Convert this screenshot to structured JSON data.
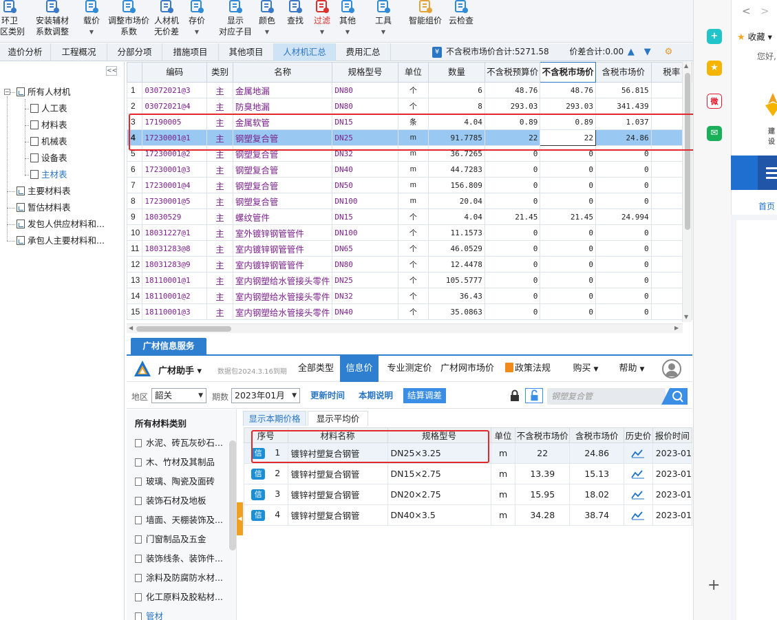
{
  "ribbon": [
    {
      "l1": "环卫",
      "l2": "区类别",
      "caret": false,
      "red": false,
      "color": "#3a78c8"
    },
    {
      "l1": "安装辅材",
      "l2": "系数调整",
      "caret": false,
      "red": false,
      "color": "#3a78c8"
    },
    {
      "l1": "载价",
      "l2": "",
      "caret": true,
      "red": false,
      "color": "#2f8ad8"
    },
    {
      "l1": "调整市场价",
      "l2": "系数",
      "caret": false,
      "red": false,
      "color": "#2f8ad8"
    },
    {
      "l1": "人材机",
      "l2": "无价差",
      "caret": false,
      "red": false,
      "color": "#3a78c8"
    },
    {
      "l1": "存价",
      "l2": "",
      "caret": true,
      "red": false,
      "color": "#2f8ad8"
    },
    {
      "l1": "显示",
      "l2": "对应子目",
      "caret": false,
      "red": false,
      "color": "#2f8ad8"
    },
    {
      "l1": "颜色",
      "l2": "",
      "caret": true,
      "red": false,
      "color": "#3a78c8"
    },
    {
      "l1": "查找",
      "l2": "",
      "caret": false,
      "red": false,
      "color": "#3a78c8"
    },
    {
      "l1": "过滤",
      "l2": "",
      "caret": true,
      "red": true,
      "color": "#d9322b"
    },
    {
      "l1": "其他",
      "l2": "",
      "caret": true,
      "red": false,
      "color": "#2f8ad8"
    },
    {
      "l1": "工具",
      "l2": "",
      "caret": true,
      "red": false,
      "color": "#2f8ad8"
    },
    {
      "l1": "智能组价",
      "l2": "",
      "caret": false,
      "red": false,
      "color": "#e2a33a"
    },
    {
      "l1": "云检查",
      "l2": "",
      "caret": false,
      "red": false,
      "color": "#2f8ad8"
    }
  ],
  "tabs": [
    "造价分析",
    "工程概况",
    "分部分项",
    "措施项目",
    "其他项目",
    "人材机汇总",
    "费用汇总"
  ],
  "active_tab": "人材机汇总",
  "summary": {
    "market_total_label": "不含税市场价合计:",
    "market_total_value": "5271.58",
    "diff_label": "价差合计:",
    "diff_value": "0.00"
  },
  "tree": {
    "collapse": "<<",
    "items": [
      {
        "label": "所有人材机",
        "level": 0
      },
      {
        "label": "人工表",
        "level": 1
      },
      {
        "label": "材料表",
        "level": 1
      },
      {
        "label": "机械表",
        "level": 1
      },
      {
        "label": "设备表",
        "level": 1
      },
      {
        "label": "主材表",
        "level": 1
      },
      {
        "label": "主要材料表",
        "level": 0
      },
      {
        "label": "暂估材料表",
        "level": 0
      },
      {
        "label": "发包人供应材料和...",
        "level": 0
      },
      {
        "label": "承包人主要材料和...",
        "level": 0
      }
    ]
  },
  "grid": {
    "columns": [
      "",
      "编码",
      "类别",
      "名称",
      "规格型号",
      "单位",
      "数量",
      "不含税预算价",
      "不含税市场价",
      "含税市场价",
      "税率"
    ],
    "rows": [
      {
        "n": "1",
        "code": "03072021@3",
        "cat": "主",
        "name": "金属地漏",
        "spec": "DN80",
        "unit": "个",
        "qty": "6",
        "budget": "48.76",
        "market": "48.76",
        "tax": "56.815"
      },
      {
        "n": "2",
        "code": "03072021@4",
        "cat": "主",
        "name": "防臭地漏",
        "spec": "DN80",
        "unit": "个",
        "qty": "8",
        "budget": "293.03",
        "market": "293.03",
        "tax": "341.439"
      },
      {
        "n": "3",
        "code": "17190005",
        "cat": "主",
        "name": "金属软管",
        "spec": "DN15",
        "unit": "条",
        "qty": "4.04",
        "budget": "0.89",
        "market": "0.89",
        "tax": "1.037"
      },
      {
        "n": "4",
        "code": "17230001@1",
        "cat": "主",
        "name": "钢塑复合管",
        "spec": "DN25",
        "unit": "m",
        "qty": "91.7785",
        "budget": "22",
        "market": "22",
        "tax": "24.86"
      },
      {
        "n": "5",
        "code": "17230001@2",
        "cat": "主",
        "name": "钢塑复合管",
        "spec": "DN32",
        "unit": "m",
        "qty": "36.7265",
        "budget": "0",
        "market": "0",
        "tax": "0"
      },
      {
        "n": "6",
        "code": "17230001@3",
        "cat": "主",
        "name": "钢塑复合管",
        "spec": "DN40",
        "unit": "m",
        "qty": "44.7283",
        "budget": "0",
        "market": "0",
        "tax": "0"
      },
      {
        "n": "7",
        "code": "17230001@4",
        "cat": "主",
        "name": "钢塑复合管",
        "spec": "DN50",
        "unit": "m",
        "qty": "156.809",
        "budget": "0",
        "market": "0",
        "tax": "0"
      },
      {
        "n": "8",
        "code": "17230001@5",
        "cat": "主",
        "name": "钢塑复合管",
        "spec": "DN100",
        "unit": "m",
        "qty": "20.04",
        "budget": "0",
        "market": "0",
        "tax": "0"
      },
      {
        "n": "9",
        "code": "18030529",
        "cat": "主",
        "name": "螺纹管件",
        "spec": "DN15",
        "unit": "个",
        "qty": "4.04",
        "budget": "21.45",
        "market": "21.45",
        "tax": "24.994"
      },
      {
        "n": "10",
        "code": "18031227@1",
        "cat": "主",
        "name": "室外镀锌钢管管件",
        "spec": "DN100",
        "unit": "个",
        "qty": "11.1573",
        "budget": "0",
        "market": "0",
        "tax": "0"
      },
      {
        "n": "11",
        "code": "18031283@8",
        "cat": "主",
        "name": "室内镀锌钢管管件",
        "spec": "DN65",
        "unit": "个",
        "qty": "46.0529",
        "budget": "0",
        "market": "0",
        "tax": "0"
      },
      {
        "n": "12",
        "code": "18031283@9",
        "cat": "主",
        "name": "室内镀锌钢管管件",
        "spec": "DN80",
        "unit": "个",
        "qty": "12.4478",
        "budget": "0",
        "market": "0",
        "tax": "0"
      },
      {
        "n": "13",
        "code": "18110001@1",
        "cat": "主",
        "name": "室内钢塑给水管接头零件",
        "spec": "DN25",
        "unit": "个",
        "qty": "105.5777",
        "budget": "0",
        "market": "0",
        "tax": "0"
      },
      {
        "n": "14",
        "code": "18110001@2",
        "cat": "主",
        "name": "室内钢塑给水管接头零件",
        "spec": "DN32",
        "unit": "个",
        "qty": "36.43",
        "budget": "0",
        "market": "0",
        "tax": "0"
      },
      {
        "n": "15",
        "code": "18110001@3",
        "cat": "主",
        "name": "室内钢塑给水管接头零件",
        "spec": "DN40",
        "unit": "个",
        "qty": "35.0863",
        "budget": "0",
        "market": "0",
        "tax": "0"
      }
    ]
  },
  "service": {
    "panel_title": "广材信息服务",
    "assistant": "广材助手",
    "package": "数据包2024.3.16到期",
    "nav": [
      "全部类型",
      "信息价",
      "专业测定价",
      "广材网市场价",
      "政策法规",
      "购买",
      "帮助"
    ],
    "active_nav": "信息价",
    "region_label": "地区",
    "region": "韶关",
    "period_label": "期数",
    "period": "2023年01月",
    "btn_update": "更新时间",
    "btn_note": "本期说明",
    "btn_settle": "结算调差",
    "search_placeholder": "钢塑复合管"
  },
  "categories": {
    "title": "所有材料类别",
    "items": [
      "水泥、砖瓦灰砂石...",
      "木、竹材及其制品",
      "玻璃、陶瓷及面砖",
      "装饰石材及地板",
      "墙面、天棚装饰及...",
      "门窗制品及五金",
      "装饰线条、装饰件...",
      "涂料及防腐防水材...",
      "化工原料及胶粘材...",
      "管材"
    ]
  },
  "price": {
    "tabs": [
      "显示本期价格",
      "显示平均价"
    ],
    "columns": [
      "序号",
      "材料名称",
      "规格型号",
      "单位",
      "不含税市场价",
      "含税市场价",
      "历史价",
      "报价时间"
    ],
    "badge": "信",
    "rows": [
      {
        "n": "1",
        "name": "镀锌衬塑复合钢管",
        "spec": "DN25×3.25",
        "unit": "m",
        "ex": "22",
        "inc": "24.86",
        "date": "2023-01"
      },
      {
        "n": "2",
        "name": "镀锌衬塑复合钢管",
        "spec": "DN15×2.75",
        "unit": "m",
        "ex": "13.39",
        "inc": "15.13",
        "date": "2023-01"
      },
      {
        "n": "3",
        "name": "镀锌衬塑复合钢管",
        "spec": "DN20×2.75",
        "unit": "m",
        "ex": "15.95",
        "inc": "18.02",
        "date": "2023-01"
      },
      {
        "n": "4",
        "name": "镀锌衬塑复合钢管",
        "spec": "DN40×3.5",
        "unit": "m",
        "ex": "34.28",
        "inc": "38.74",
        "date": "2023-01"
      }
    ]
  },
  "browser": {
    "favorites": "收藏",
    "greeting": "您好,",
    "logo_text": "建设",
    "home": "首页"
  }
}
